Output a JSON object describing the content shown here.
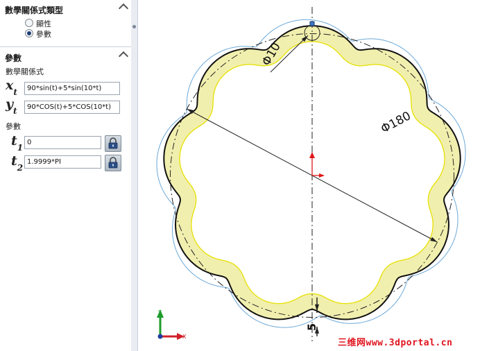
{
  "panel": {
    "equation_type": {
      "title": "數學關係式類型",
      "options": [
        {
          "label": "顯性",
          "selected": false
        },
        {
          "label": "參數",
          "selected": true
        }
      ]
    },
    "parameters": {
      "title": "參數",
      "equation_label": "數學關係式",
      "xt": {
        "symbol": "x",
        "sub": "t",
        "value": "90*sin(t)+5*sin(10*t)"
      },
      "yt": {
        "symbol": "y",
        "sub": "t",
        "value": "90*COS(t)+5*COS(10*t)"
      },
      "param_label": "參數",
      "t1": {
        "symbol": "t",
        "sub": "1",
        "value": "0"
      },
      "t2": {
        "symbol": "t",
        "sub": "2",
        "value": "1.9999*PI"
      }
    }
  },
  "drawing": {
    "dim_small": "10",
    "dim_large": "180",
    "dim_thickness": "5",
    "triad": {
      "x_label": "X",
      "y_label": "Y"
    }
  },
  "watermark": "三维网www.3dportal.cn",
  "colors": {
    "profile_fill": "#f1efae",
    "offset_line": "#e6e000",
    "construction": "#6aa8d8",
    "dimension": "#222222",
    "origin": "#e01818",
    "accent": "#1e3d72"
  },
  "icons": [
    "chevron-up-icon",
    "lock-icon",
    "radio-icon",
    "origin-icon",
    "triad-icon"
  ]
}
